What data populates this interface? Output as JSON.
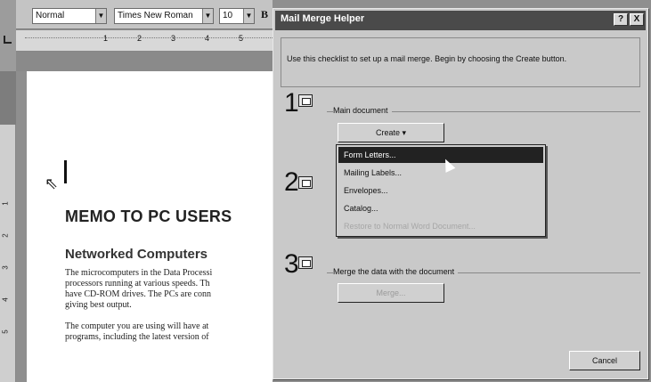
{
  "toolbar": {
    "style_value": "Normal",
    "font_value": "Times New Roman",
    "size_value": "10",
    "bold_label": "B"
  },
  "ruler": {
    "numbers": [
      "1",
      "2",
      "3",
      "4",
      "5"
    ]
  },
  "vruler": {
    "numbers": [
      "1",
      "2",
      "3",
      "4",
      "5"
    ]
  },
  "document": {
    "title": "MEMO TO PC USERS",
    "heading": "Networked Computers",
    "para1": [
      "The microcomputers in the Data Processi",
      "processors running at various speeds. Th",
      "have CD-ROM drives. The PCs are conn",
      "giving best output."
    ],
    "para2": [
      "The computer you are using will have at",
      "programs, including the latest version of"
    ]
  },
  "dialog": {
    "title": "Mail Merge Helper",
    "help_btn": "?",
    "close_btn": "X",
    "intro": "Use this checklist to set up a mail merge. Begin by choosing the Create button.",
    "steps": [
      {
        "number": "1",
        "label": "Main document",
        "button": "Create ▾"
      },
      {
        "number": "2",
        "label": "",
        "button": ""
      },
      {
        "number": "3",
        "label": "Merge the data with the document",
        "button": "Merge..."
      }
    ],
    "cancel": "Cancel"
  },
  "create_menu": {
    "items": [
      "Form Letters...",
      "Mailing Labels...",
      "Envelopes...",
      "Catalog...",
      "Restore to Normal Word Document..."
    ]
  }
}
